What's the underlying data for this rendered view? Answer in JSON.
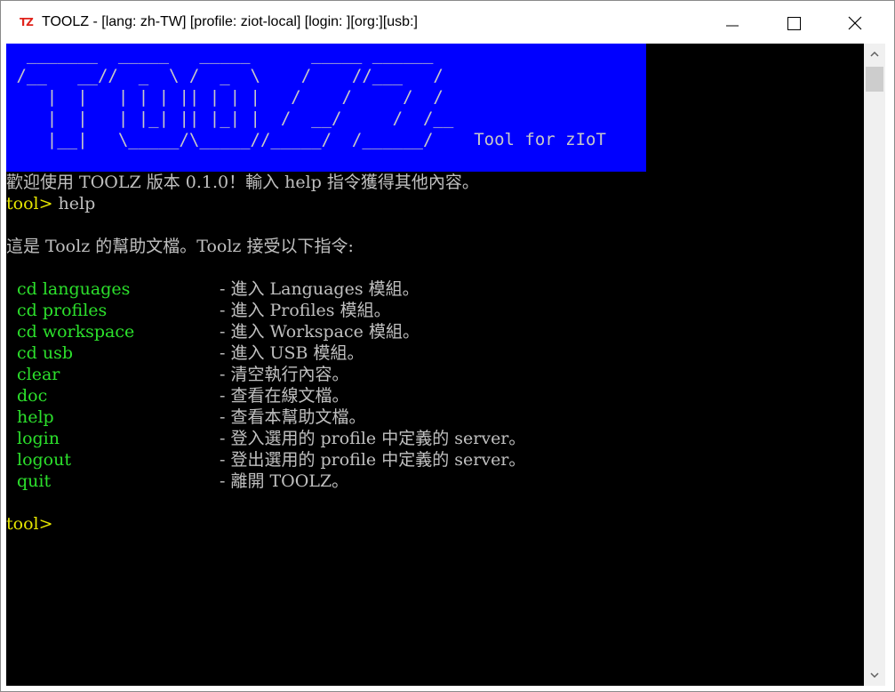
{
  "window": {
    "icon_text": "TZ",
    "title": "TOOLZ - [lang: zh-TW] [profile: ziot-local] [login: ][org:][usb:]"
  },
  "banner": {
    "ascii": "  _______  _____   _____      _____ ______\n /__   __//  _  \\ /  _  \\    /    //___   /\n    |  |   | | | || | | |   /    /     /  /\n    |  |   | |_| || |_| |  /  __/     /  /__\n    |__|   \\_____/\\_____//_____/  /______/    Tool for zIoT",
    "colors": {
      "background": "#0000ff",
      "text": "#c8c8c8"
    }
  },
  "terminal": {
    "welcome": "歡迎使用 TOOLZ 版本 0.1.0！輸入 help 指令獲得其他內容。",
    "prompt": "tool>",
    "first_command": " help",
    "help_intro": "這是 Toolz 的幫助文檔。Toolz 接受以下指令:",
    "commands": [
      {
        "name": "cd languages",
        "desc": "- 進入 Languages 模組。"
      },
      {
        "name": "cd profiles",
        "desc": "- 進入 Profiles 模組。"
      },
      {
        "name": "cd workspace",
        "desc": "- 進入 Workspace 模組。"
      },
      {
        "name": "cd usb",
        "desc": "- 進入 USB 模組。"
      },
      {
        "name": "clear",
        "desc": "- 清空執行內容。"
      },
      {
        "name": "doc",
        "desc": "- 查看在線文檔。"
      },
      {
        "name": "help",
        "desc": "- 查看本幫助文檔。"
      },
      {
        "name": "login",
        "desc": "- 登入選用的 profile 中定義的 server。"
      },
      {
        "name": "logout",
        "desc": "- 登出選用的 profile 中定義的 server。"
      },
      {
        "name": "quit",
        "desc": "- 離開 TOOLZ。"
      }
    ],
    "final_prompt": "tool>",
    "colors": {
      "prompt": "#e6e600",
      "command": "#2ce02c",
      "text": "#c0c0c0",
      "background": "#000000"
    }
  },
  "icons": {
    "minimize": "minimize-icon",
    "maximize": "maximize-icon",
    "close": "close-icon",
    "scroll_up": "chevron-up-icon",
    "scroll_down": "chevron-down-icon"
  }
}
